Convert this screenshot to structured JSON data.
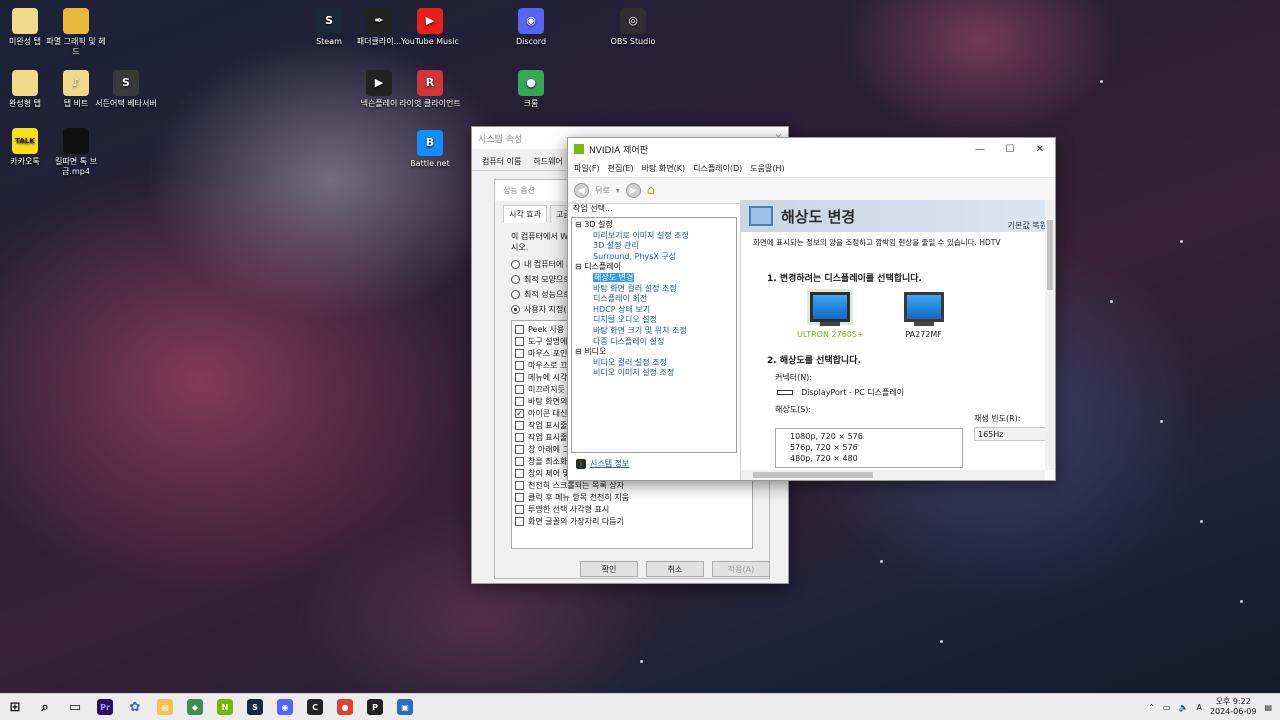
{
  "desktop": {
    "icons": [
      {
        "label": "미완성 탭",
        "glyph": "",
        "color": "#f1d98a"
      },
      {
        "label": "파멸 그래픽 및 헤드",
        "glyph": "",
        "color": "#e9b73c"
      },
      {
        "label": "완성형 탭",
        "glyph": "",
        "color": "#f1d98a"
      },
      {
        "label": "탭 비트",
        "glyph": "♪",
        "color": "#f1d98a"
      },
      {
        "label": "서든어택 베타서버",
        "glyph": "S",
        "color": "#3a3a3a"
      },
      {
        "label": "카카오톡",
        "glyph": "TALK",
        "color": "#f7df1e"
      },
      {
        "label": "킬따면 톡 브금.mp4",
        "glyph": "",
        "color": "#111111"
      },
      {
        "label": "Steam",
        "glyph": "S",
        "color": "#1b2838"
      },
      {
        "label": "패더클라이...",
        "glyph": "✒",
        "color": "#222222"
      },
      {
        "label": "YouTube Music",
        "glyph": "▶",
        "color": "#e62117"
      },
      {
        "label": "Discord",
        "glyph": "◉",
        "color": "#5865f2"
      },
      {
        "label": "OBS Studio",
        "glyph": "◎",
        "color": "#302e31"
      },
      {
        "label": "넥슨플레이",
        "glyph": "▶",
        "color": "#222222"
      },
      {
        "label": "라이엇 클라이언트",
        "glyph": "R",
        "color": "#d13639"
      },
      {
        "label": "크롬",
        "glyph": "●",
        "color": "#34a853"
      },
      {
        "label": "Battle.net",
        "glyph": "B",
        "color": "#148eff"
      }
    ]
  },
  "sysprops": {
    "title": "시스템 속성",
    "tabs": [
      "컴퓨터 이름",
      "하드웨어"
    ],
    "perf_title": "성능 옵션",
    "perf_tabs": [
      "시각 효과",
      "고급"
    ],
    "desc": "이 컴퓨터에서 W\n시오.",
    "radios": [
      {
        "label": "내 컴퓨터에 가",
        "on": false
      },
      {
        "label": "최적 모양으로",
        "on": false
      },
      {
        "label": "최적 성능으로",
        "on": false
      },
      {
        "label": "사용자 지정(C",
        "on": true
      }
    ],
    "checkboxes": [
      {
        "label": "Peek 사용",
        "checked": false
      },
      {
        "label": "도구 설명에",
        "checked": false
      },
      {
        "label": "마우스 포인",
        "checked": false
      },
      {
        "label": "마우스로 끄",
        "checked": false
      },
      {
        "label": "메뉴에 시각",
        "checked": false
      },
      {
        "label": "미끄러지듯",
        "checked": false
      },
      {
        "label": "바탕 화면의",
        "checked": false
      },
      {
        "label": "아이콘 대신",
        "checked": true
      },
      {
        "label": "작업 표시줄",
        "checked": false
      },
      {
        "label": "작업 표시줄",
        "checked": false
      },
      {
        "label": "창 아래에 그",
        "checked": false
      },
      {
        "label": "창을 최소화",
        "checked": false
      },
      {
        "label": "창의 제어 및",
        "checked": false
      },
      {
        "label": "천천히 스크롤되는 목록 상자",
        "checked": false
      },
      {
        "label": "클릭 후 메뉴 항목 천천히 지움",
        "checked": false
      },
      {
        "label": "투명한 선택 사각형 표시",
        "checked": false
      },
      {
        "label": "화면 글꼴의 가장자리 다듬기",
        "checked": false
      }
    ],
    "buttons": {
      "ok": "확인",
      "cancel": "취소",
      "apply": "적용(A)"
    }
  },
  "nvidia": {
    "title": "NVIDIA 제어판",
    "menu": [
      "파일(F)",
      "편집(E)",
      "바탕 화면(K)",
      "디스플레이(D)",
      "도움말(H)"
    ],
    "toolbar": {
      "back": "뒤로"
    },
    "task_label": "작업 선택...",
    "tree": [
      {
        "type": "cat",
        "label": "⊟ 3D 설정"
      },
      {
        "type": "item",
        "label": "미리보기로 이미지 설정 조정"
      },
      {
        "type": "item",
        "label": "3D 설정 관리"
      },
      {
        "type": "item",
        "label": "Surround, PhysX 구성"
      },
      {
        "type": "cat",
        "label": "⊟ 디스플레이"
      },
      {
        "type": "item",
        "label": "해상도 변경",
        "selected": true
      },
      {
        "type": "item",
        "label": "바탕 화면 컬러 설정 조정"
      },
      {
        "type": "item",
        "label": "디스플레이 회전"
      },
      {
        "type": "item",
        "label": "HDCP 상태 보기"
      },
      {
        "type": "item",
        "label": "디지털 오디오 설정"
      },
      {
        "type": "item",
        "label": "바탕 화면 크기 및 위치 조정"
      },
      {
        "type": "item",
        "label": "다중 디스플레이 설정"
      },
      {
        "type": "cat",
        "label": "⊟ 비디오"
      },
      {
        "type": "item",
        "label": "비디오 컬러 설정 조정"
      },
      {
        "type": "item",
        "label": "비디오 이미지 설정 조정"
      }
    ],
    "sysinfo": "시스템 정보",
    "page_title": "해상도 변경",
    "defaults": "기본값 복원",
    "page_desc": "화면에 표시되는 정보의 양을 조정하고 깜박임 현상을 줄일 수 있습니다. HDTV",
    "step1": "1. 변경하려는 디스플레이를 선택합니다.",
    "monitors": [
      {
        "label": "ULTRON 2760S+",
        "active": true
      },
      {
        "label": "PA272MF",
        "active": false
      }
    ],
    "step2": "2. 해상도를 선택합니다.",
    "connector_label": "커넥터(N):",
    "connector": "DisplayPort - PC 디스플레이",
    "resolution_label": "해상도(S):",
    "resolutions": [
      "1080p, 720 × 576",
      "576p, 720 × 576",
      "480p, 720 × 480"
    ],
    "refresh_label": "재생 빈도(R):",
    "refresh": "165Hz"
  },
  "taskbar": {
    "apps": [
      {
        "name": "start-icon",
        "glyph": "⊞",
        "color": "#ececec",
        "fg": "#111111"
      },
      {
        "name": "search-icon",
        "glyph": "⌕",
        "color": "#ececec",
        "fg": "#111111"
      },
      {
        "name": "task-view-icon",
        "glyph": "▭",
        "color": "#ececec",
        "fg": "#111111"
      },
      {
        "name": "premiere-icon",
        "glyph": "Pr",
        "color": "#2a0f5c",
        "fg": "#9999ff"
      },
      {
        "name": "app-icon",
        "glyph": "✿",
        "color": "#ececec",
        "fg": "#2b6cc4"
      },
      {
        "name": "explorer-icon",
        "glyph": "▤",
        "color": "#f2c14e",
        "fg": "#ffffff"
      },
      {
        "name": "app2-icon",
        "glyph": "◆",
        "color": "#3c8d5a",
        "fg": "#ffffff"
      },
      {
        "name": "nvidia-icon",
        "glyph": "N",
        "color": "#76b900",
        "fg": "#ffffff"
      },
      {
        "name": "steam-icon",
        "glyph": "S",
        "color": "#1b2838",
        "fg": "#ffffff"
      },
      {
        "name": "discord-icon",
        "glyph": "◉",
        "color": "#5865f2",
        "fg": "#ffffff"
      },
      {
        "name": "app3-icon",
        "glyph": "C",
        "color": "#222222",
        "fg": "#ffffff"
      },
      {
        "name": "chrome-icon",
        "glyph": "●",
        "color": "#db4437",
        "fg": "#ffffff"
      },
      {
        "name": "nexon-icon",
        "glyph": "P",
        "color": "#222222",
        "fg": "#ffffff"
      },
      {
        "name": "sysprops-icon",
        "glyph": "▣",
        "color": "#2b6cc4",
        "fg": "#ffffff"
      }
    ],
    "tray_lang": "A",
    "time": "오후 9:22",
    "date": "2024-06-09"
  }
}
